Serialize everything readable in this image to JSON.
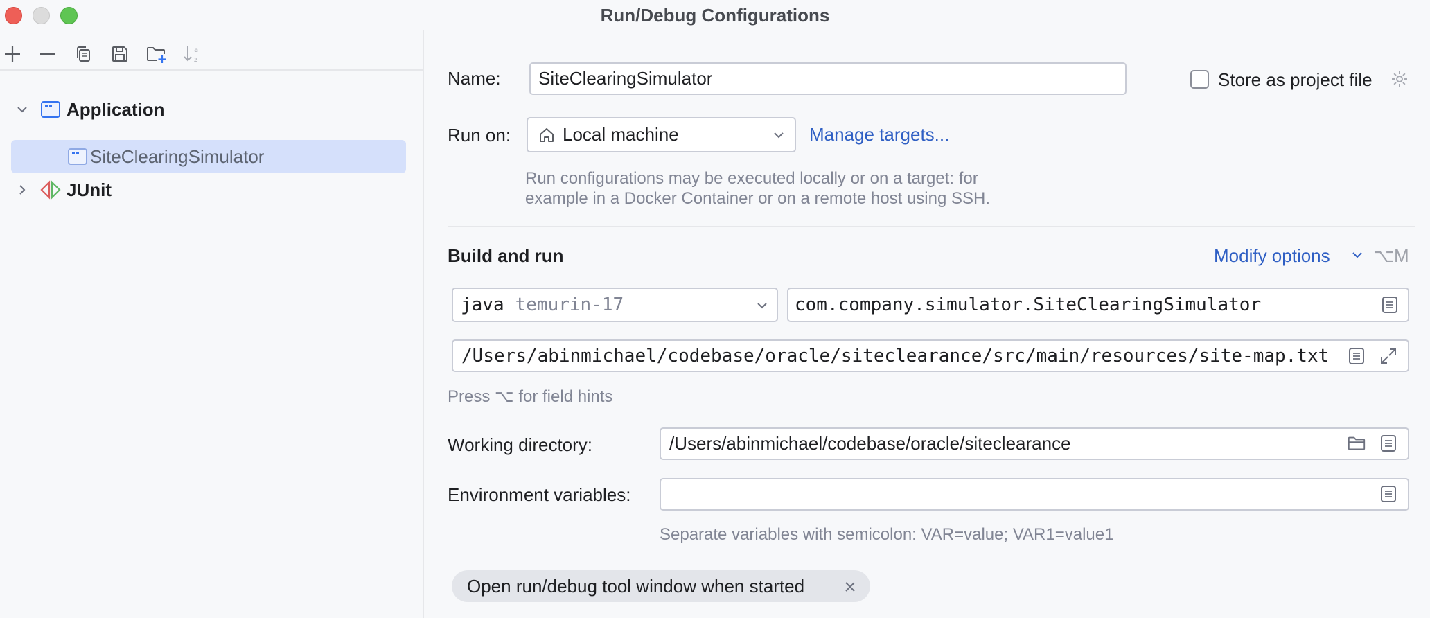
{
  "window": {
    "title": "Run/Debug Configurations"
  },
  "toolbar": {
    "items": [
      "add-icon",
      "remove-icon",
      "copy-icon",
      "save-icon",
      "new-folder-icon",
      "sort-icon"
    ]
  },
  "tree": {
    "groups": [
      {
        "label": "Application",
        "expanded": true,
        "children": [
          "SiteClearingSimulator"
        ]
      },
      {
        "label": "JUnit",
        "expanded": false
      }
    ]
  },
  "form": {
    "name_label": "Name:",
    "name_value": "SiteClearingSimulator",
    "store_label": "Store as project file",
    "run_on_label": "Run on:",
    "run_on_value": "Local machine",
    "manage_targets": "Manage targets...",
    "run_on_hint_line1": "Run configurations may be executed locally or on a target: for",
    "run_on_hint_line2": "example in a Docker Container or on a remote host using SSH.",
    "build_run_title": "Build and run",
    "modify_options": "Modify options",
    "modify_shortcut": "⌥M",
    "jdk_prefix": "java",
    "jdk_value": "temurin-17",
    "main_class": "com.company.simulator.SiteClearingSimulator",
    "program_args": "/Users/abinmichael/codebase/oracle/siteclearance/src/main/resources/site-map.txt",
    "field_hints": "Press ⌥ for field hints",
    "working_dir_label": "Working directory:",
    "working_dir_value": "/Users/abinmichael/codebase/oracle/siteclearance",
    "env_label": "Environment variables:",
    "env_value": "",
    "env_hint": "Separate variables with semicolon: VAR=value; VAR1=value1",
    "open_tool_window_chip": "Open run/debug tool window when started"
  },
  "colors": {
    "accent": "#3574f0",
    "link": "#2f5fc4",
    "selection": "#d5e0fb",
    "junit_red": "#db5c5c",
    "junit_green": "#5fb865"
  }
}
